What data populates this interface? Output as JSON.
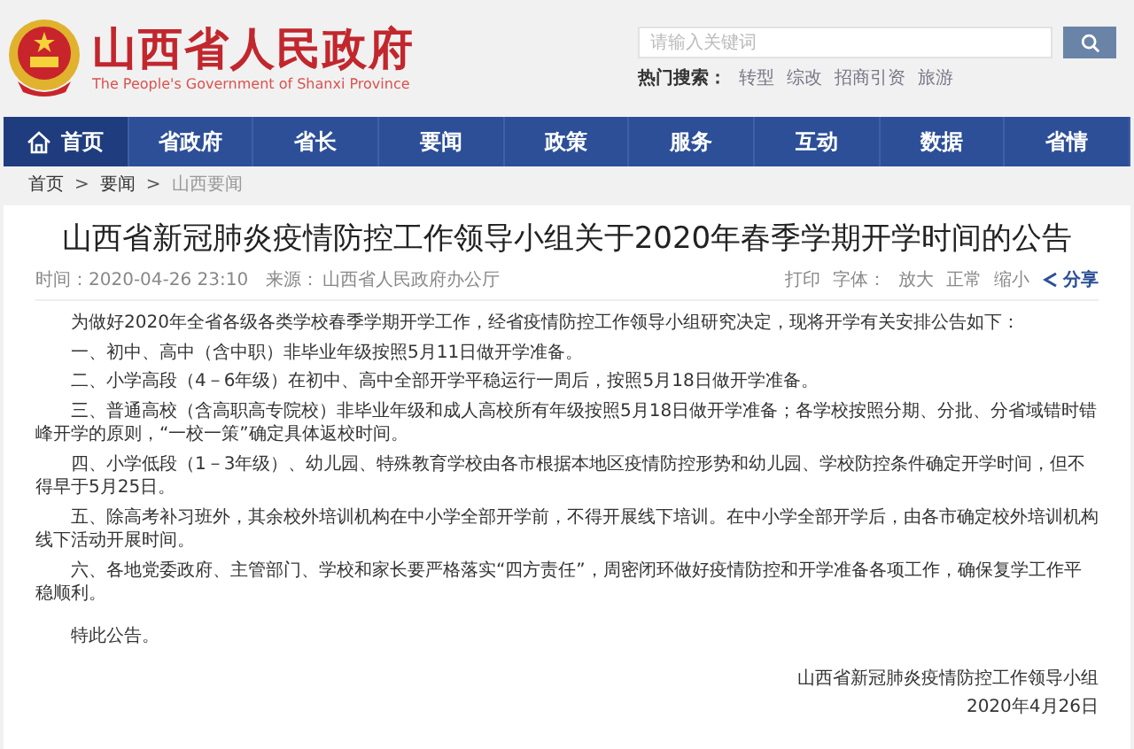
{
  "header": {
    "site_title": "山西省人民政府",
    "site_subtitle": "The People's Government of Shanxi Province",
    "search": {
      "placeholder": "请输入关键词"
    },
    "hot_search": {
      "label": "热门搜索：",
      "terms": [
        "转型",
        "综改",
        "招商引资",
        "旅游"
      ]
    }
  },
  "nav": [
    {
      "label": "首页",
      "selected": true
    },
    {
      "label": "省政府",
      "selected": false
    },
    {
      "label": "省长",
      "selected": false
    },
    {
      "label": "要闻",
      "selected": false
    },
    {
      "label": "政策",
      "selected": false
    },
    {
      "label": "服务",
      "selected": false
    },
    {
      "label": "互动",
      "selected": false
    },
    {
      "label": "数据",
      "selected": false
    },
    {
      "label": "省情",
      "selected": false
    }
  ],
  "breadcrumb": {
    "separator": ">",
    "items": [
      "首页",
      "要闻",
      "山西要闻"
    ]
  },
  "article": {
    "title": "山西省新冠肺炎疫情防控工作领导小组关于2020年春季学期开学时间的公告",
    "meta": {
      "time": "时间：2020-04-26 23:10",
      "source": "来源：",
      "source_name": "山西省人民政府办公厅"
    },
    "tools": {
      "print": "打印",
      "font_label": "字体：",
      "font_options": [
        "放大",
        "正常",
        "缩小"
      ],
      "share": "分享"
    },
    "paragraphs": [
      "为做好2020年全省各级各类学校春季学期开学工作，经省疫情防控工作领导小组研究决定，现将开学有关安排公告如下：",
      "一、初中、高中（含中职）非毕业年级按照5月11日做开学准备。",
      "二、小学高段（4－6年级）在初中、高中全部开学平稳运行一周后，按照5月18日做开学准备。",
      "三、普通高校（含高职高专院校）非毕业年级和成人高校所有年级按照5月18日做开学准备；各学校按照分期、分批、分省域错时错峰开学的原则，“一校一策”确定具体返校时间。",
      "四、小学低段（1－3年级）、幼儿园、特殊教育学校由各市根据本地区疫情防控形势和幼儿园、学校防控条件确定开学时间，但不得早于5月25日。",
      "五、除高考补习班外，其余校外培训机构在中小学全部开学前，不得开展线下培训。在中小学全部开学后，由各市确定校外培训机构线下活动开展时间。",
      "六、各地党委政府、主管部门、学校和家长要严格落实“四方责任”，周密闭环做好疫情防控和开学准备各项工作，确保复学工作平稳顺利。"
    ],
    "closing": "特此公告。",
    "signature": "山西省新冠肺炎疫情防控工作领导小组",
    "date": "2020年4月26日"
  }
}
